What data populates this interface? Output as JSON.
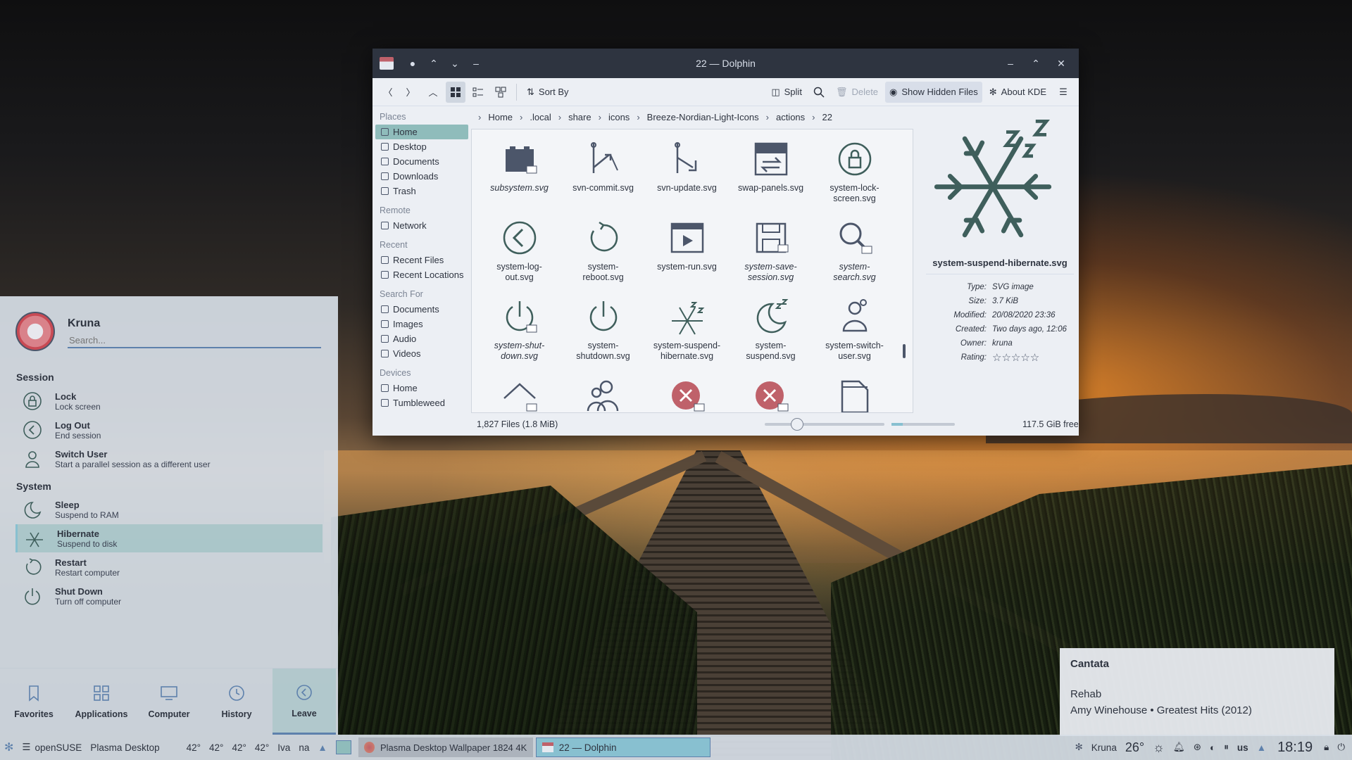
{
  "window": {
    "title": "22 — Dolphin",
    "toolbar": {
      "split": "Split",
      "sort_by": "Sort By",
      "delete": "Delete",
      "show_hidden": "Show Hidden Files",
      "about_kde": "About KDE"
    },
    "places": {
      "headings": {
        "places": "Places",
        "remote": "Remote",
        "recent": "Recent",
        "search_for": "Search For",
        "devices": "Devices"
      },
      "places_items": [
        "Home",
        "Desktop",
        "Documents",
        "Downloads",
        "Trash"
      ],
      "remote_items": [
        "Network"
      ],
      "recent_items": [
        "Recent Files",
        "Recent Locations"
      ],
      "search_items": [
        "Documents",
        "Images",
        "Audio",
        "Videos"
      ],
      "device_items": [
        "Home",
        "Tumbleweed"
      ]
    },
    "breadcrumb": [
      "Home",
      ".local",
      "share",
      "icons",
      "Breeze-Nordian-Light-Icons",
      "actions",
      "22"
    ],
    "files": [
      {
        "name": "subsystem.svg",
        "italic": true
      },
      {
        "name": "svn-commit.svg"
      },
      {
        "name": "svn-update.svg"
      },
      {
        "name": "swap-panels.svg"
      },
      {
        "name": "system-lock-screen.svg"
      },
      {
        "name": "system-log-out.svg"
      },
      {
        "name": "system-reboot.svg"
      },
      {
        "name": "system-run.svg"
      },
      {
        "name": "system-save-session.svg",
        "italic": true
      },
      {
        "name": "system-search.svg",
        "italic": true
      },
      {
        "name": "system-shut-down.svg",
        "italic": true
      },
      {
        "name": "system-shutdown.svg"
      },
      {
        "name": "system-suspend-hibernate.svg"
      },
      {
        "name": "system-suspend.svg"
      },
      {
        "name": "system-switch-user.svg"
      },
      {
        "name": ""
      },
      {
        "name": ""
      },
      {
        "name": ""
      },
      {
        "name": ""
      },
      {
        "name": ""
      }
    ],
    "status": {
      "count": "1,827 Files (1.8 MiB)",
      "free": "117.5 GiB free",
      "zoom_level": 0.27,
      "disk_used_fraction": 0.18
    },
    "info": {
      "file_name": "system-suspend-hibernate.svg",
      "type_label": "Type:",
      "type": "SVG image",
      "size_label": "Size:",
      "size": "3.7 KiB",
      "modified_label": "Modified:",
      "modified": "20/08/2020 23:36",
      "created_label": "Created:",
      "created": "Two days ago, 12:06",
      "owner_label": "Owner:",
      "owner": "kruna",
      "rating_label": "Rating:",
      "rating": "☆☆☆☆☆"
    }
  },
  "launcher": {
    "user_name": "Kruna",
    "search_placeholder": "Search...",
    "session_heading": "Session",
    "system_heading": "System",
    "session_items": [
      {
        "title": "Lock",
        "subtitle": "Lock screen",
        "icon": "lock-icon"
      },
      {
        "title": "Log Out",
        "subtitle": "End session",
        "icon": "logout-icon"
      },
      {
        "title": "Switch User",
        "subtitle": "Start a parallel session as a different user",
        "icon": "switch-user-icon"
      }
    ],
    "system_items": [
      {
        "title": "Sleep",
        "subtitle": "Suspend to RAM",
        "icon": "sleep-icon"
      },
      {
        "title": "Hibernate",
        "subtitle": "Suspend to disk",
        "icon": "hibernate-icon"
      },
      {
        "title": "Restart",
        "subtitle": "Restart computer",
        "icon": "restart-icon"
      },
      {
        "title": "Shut Down",
        "subtitle": "Turn off computer",
        "icon": "shutdown-icon"
      }
    ],
    "tabs": [
      "Favorites",
      "Applications",
      "Computer",
      "History",
      "Leave"
    ]
  },
  "media": {
    "player": "Cantata",
    "track": "Rehab",
    "artist_album": "Amy Winehouse • Greatest Hits (2012)"
  },
  "panel": {
    "distro": "openSUSE",
    "desktop": "Plasma Desktop",
    "temps": [
      "42°",
      "42°",
      "42°",
      "42°"
    ],
    "iva": "Iva",
    "na": "na",
    "task1": "Plasma Desktop Wallpaper 1824 4K...",
    "task2": "22 — Dolphin",
    "user": "Kruna",
    "weather": "26°",
    "layout": "us",
    "time": "18:19"
  },
  "colors": {
    "accent": "#88c0d0",
    "selection": "#8fbcbb",
    "dark": "#2e3440",
    "icon": "#4c566a",
    "icon_green": "#3f5f5c",
    "error": "#bf616a"
  }
}
